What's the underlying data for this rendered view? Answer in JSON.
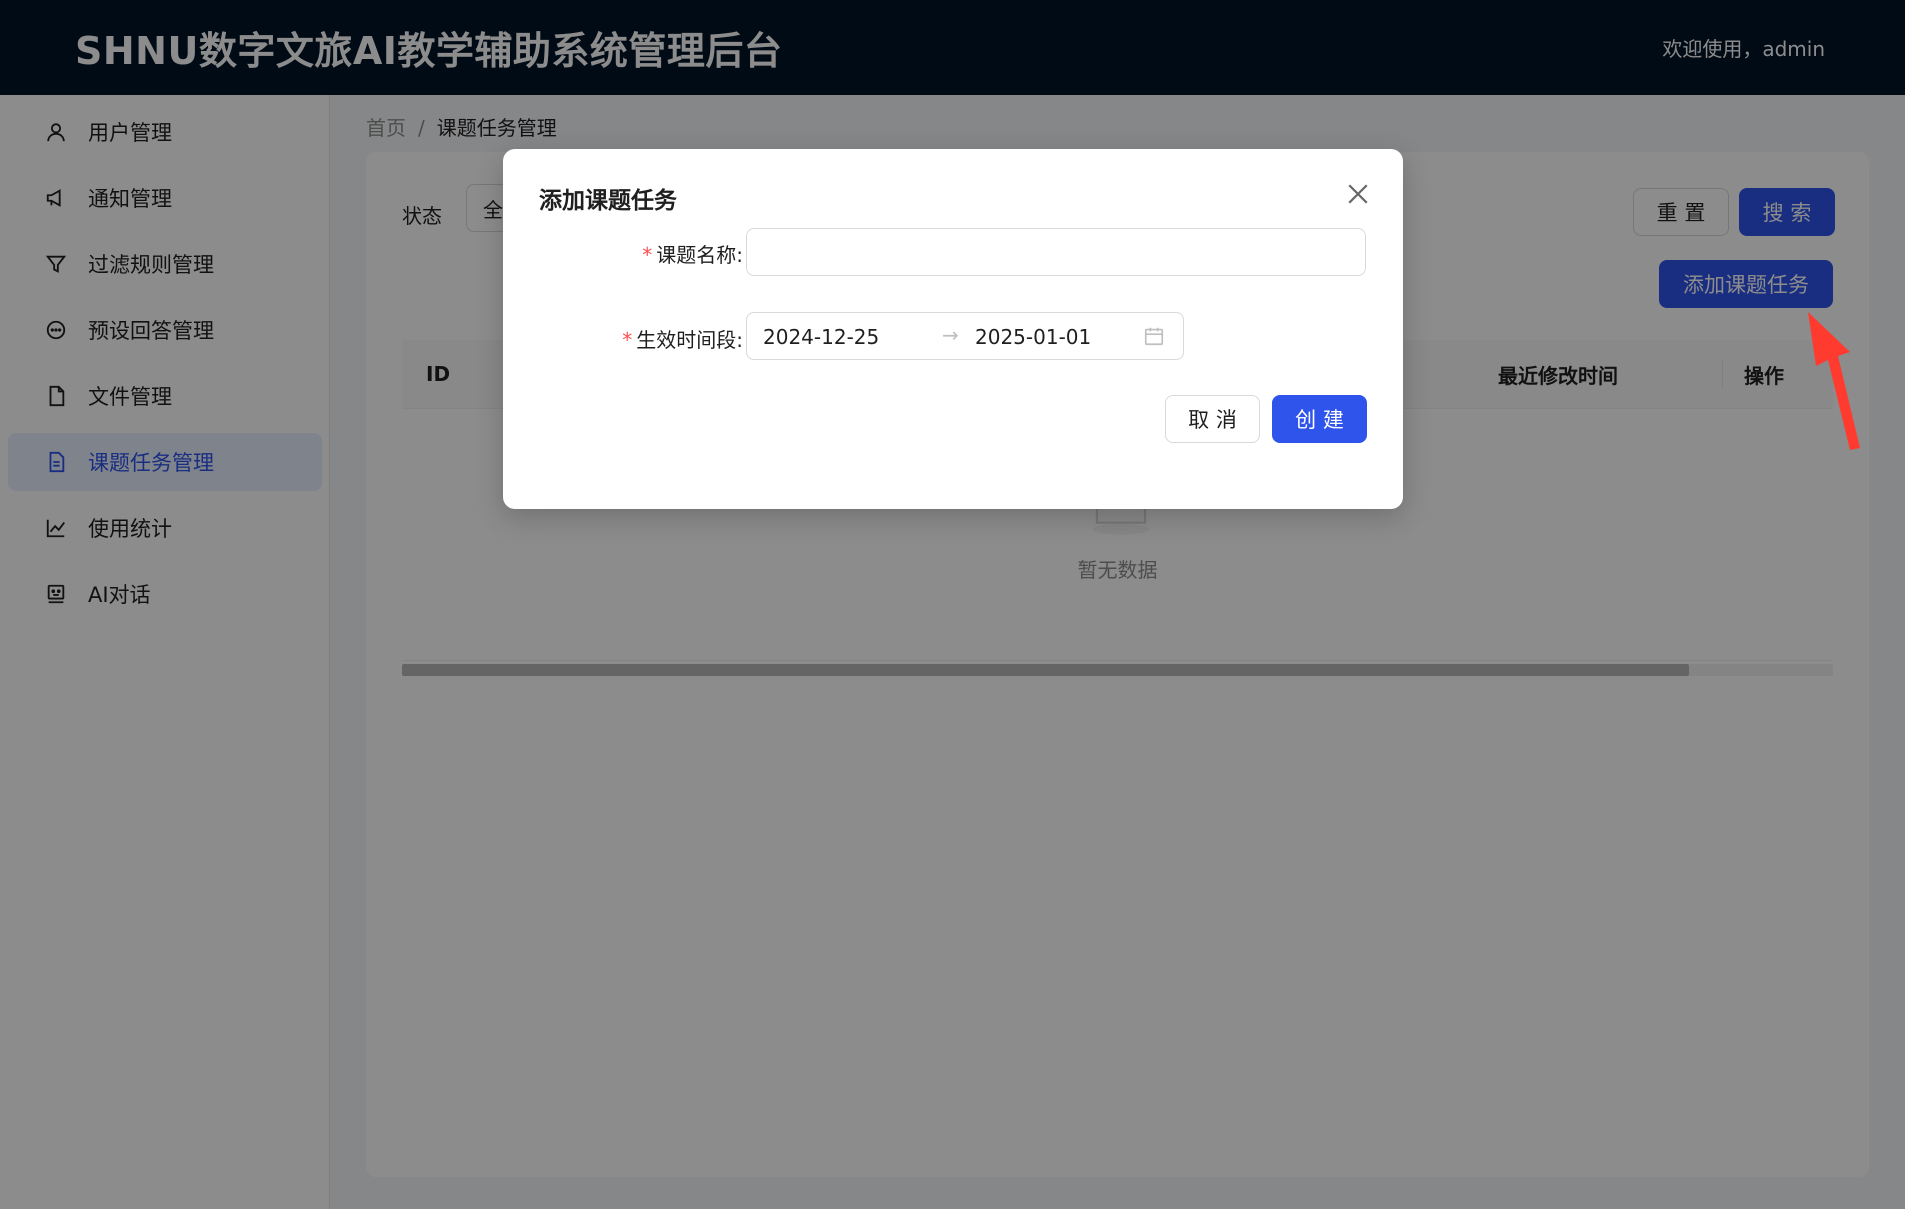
{
  "header": {
    "title": "SHNU数字文旅AI教学辅助系统管理后台",
    "welcome": "欢迎使用，admin"
  },
  "sidebar": {
    "items": [
      {
        "label": "用户管理",
        "icon": "user-icon"
      },
      {
        "label": "通知管理",
        "icon": "megaphone-icon"
      },
      {
        "label": "过滤规则管理",
        "icon": "filter-icon"
      },
      {
        "label": "预设回答管理",
        "icon": "message-icon"
      },
      {
        "label": "文件管理",
        "icon": "file-icon"
      },
      {
        "label": "课题任务管理",
        "icon": "file-text-icon",
        "active": true
      },
      {
        "label": "使用统计",
        "icon": "line-chart-icon"
      },
      {
        "label": "AI对话",
        "icon": "robot-icon"
      }
    ]
  },
  "breadcrumb": {
    "home": "首页",
    "separator": "/",
    "current": "课题任务管理"
  },
  "filter": {
    "status_label": "状态",
    "status_value": "全",
    "reset_label": "重 置",
    "search_label": "搜 索",
    "add_label": "添加课题任务"
  },
  "table": {
    "columns": [
      "ID",
      "最近修改时间",
      "操作"
    ],
    "empty_text": "暂无数据"
  },
  "modal": {
    "title": "添加课题任务",
    "name_label": "课题名称:",
    "name_value": "",
    "period_label": "生效时间段:",
    "start_date": "2024-12-25",
    "range_arrow": "→",
    "end_date": "2025-01-01",
    "cancel_label": "取 消",
    "create_label": "创 建"
  },
  "colors": {
    "header_bg": "#001529",
    "primary": "#2f54eb",
    "required": "#ff4d4f",
    "annotation_arrow": "#ff3b30"
  }
}
